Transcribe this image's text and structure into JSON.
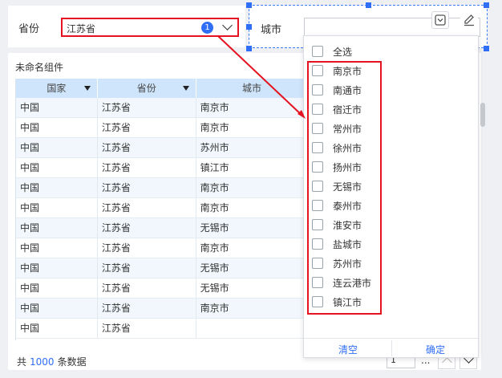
{
  "province_filter": {
    "label": "省份",
    "value": "江苏省",
    "selected_count": "1"
  },
  "city_filter": {
    "label": "城市",
    "value": ""
  },
  "table_widget": {
    "title": "未命名组件",
    "columns": [
      "国家",
      "省份",
      "城市"
    ],
    "rows": [
      [
        "中国",
        "江苏省",
        "南京市"
      ],
      [
        "中国",
        "江苏省",
        "南京市"
      ],
      [
        "中国",
        "江苏省",
        "苏州市"
      ],
      [
        "中国",
        "江苏省",
        "镇江市"
      ],
      [
        "中国",
        "江苏省",
        "南京市"
      ],
      [
        "中国",
        "江苏省",
        "南京市"
      ],
      [
        "中国",
        "江苏省",
        "无锡市"
      ],
      [
        "中国",
        "江苏省",
        "南京市"
      ],
      [
        "中国",
        "江苏省",
        "无锡市"
      ],
      [
        "中国",
        "江苏省",
        "无锡市"
      ],
      [
        "中国",
        "江苏省",
        "南京市"
      ],
      [
        "中国",
        "江苏省",
        ""
      ]
    ],
    "footer": {
      "prefix": "共",
      "total": "1000",
      "suffix": "条数据",
      "page": "1",
      "ellipsis": "..."
    }
  },
  "city_dropdown": {
    "select_all": "全选",
    "options": [
      "南京市",
      "南通市",
      "宿迁市",
      "常州市",
      "徐州市",
      "扬州市",
      "无锡市",
      "泰州市",
      "淮安市",
      "盐城市",
      "苏州市",
      "连云港市",
      "镇江市"
    ],
    "clear_label": "清空",
    "confirm_label": "确定"
  },
  "colors": {
    "accent": "#2f6ef6",
    "highlight": "#e5121f",
    "header_bg": "#cfe5fb"
  }
}
